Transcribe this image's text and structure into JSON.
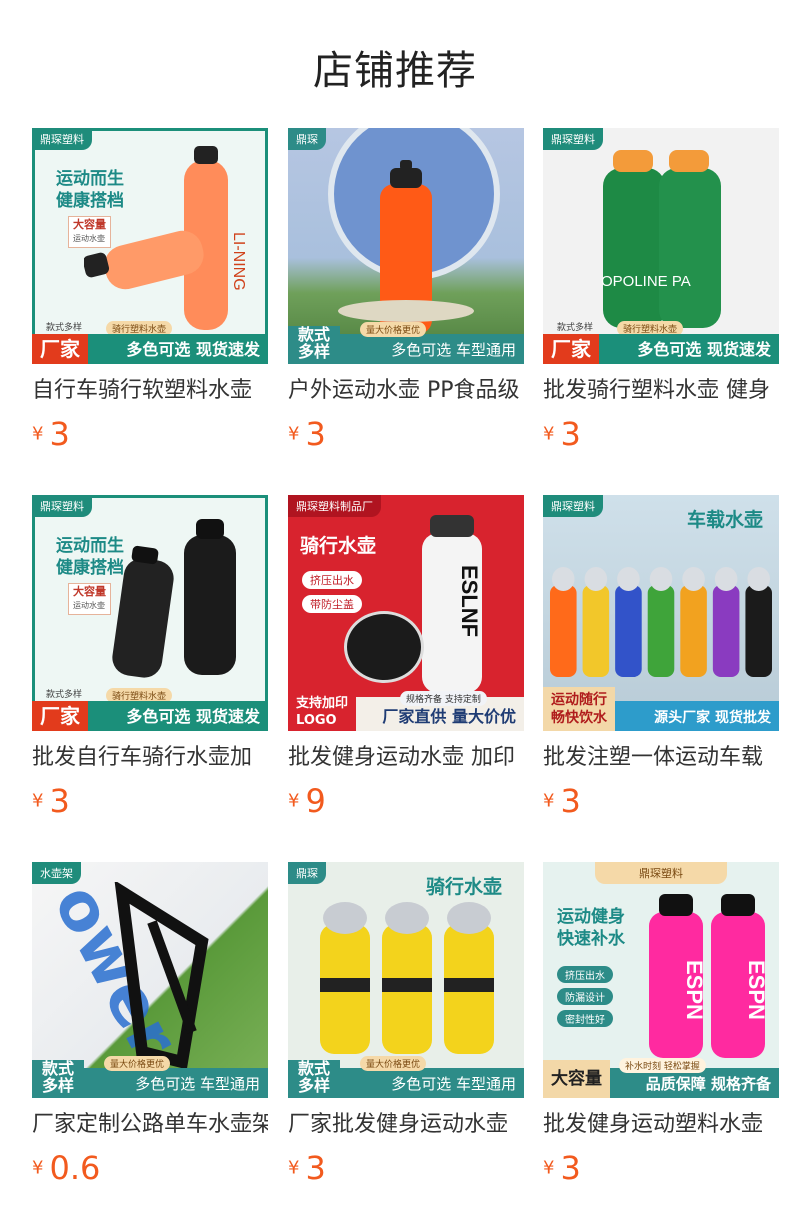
{
  "page": {
    "title": "店铺推荐"
  },
  "colors": {
    "price": "#f25a1e",
    "brand_teal": "#1b8f7a",
    "factory_red": "#e23b1c"
  },
  "currency": "¥",
  "products": [
    {
      "name": "自行车骑行软塑料水壶",
      "price": "3",
      "thumb": {
        "brand": "鼎琛塑料",
        "headline": [
          "运动而生",
          "健康搭档"
        ],
        "big": "大容量",
        "big_sub": "运动水壶",
        "small": "款式多样",
        "pill": "骑行塑料水壶",
        "left": "厂家",
        "band": "多色可选 现货速发",
        "bottle_color": "#ff8c5a",
        "bottle_text": "LI-NING",
        "icon": "orange-bottle-icon"
      }
    },
    {
      "name": "户外运动水壶 PP食品级",
      "price": "3",
      "thumb": {
        "brand": "鼎琛",
        "left_lines": [
          "款式",
          "多样"
        ],
        "pill": "量大价格更优",
        "band": "多色可选 车型通用",
        "bottle_color": "#ff5a16",
        "icon": "orange-bottle-icon"
      }
    },
    {
      "name": "批发骑行塑料水壶 健身",
      "price": "3",
      "thumb": {
        "brand": "鼎琛塑料",
        "small": "款式多样",
        "pill": "骑行塑料水壶",
        "left": "厂家",
        "band": "多色可选 现货速发",
        "bottle_color": "#1e8a45",
        "bottle_text": "OPOLINE PA",
        "icon": "green-bottle-icon"
      }
    },
    {
      "name": "批发自行车骑行水壶加",
      "price": "3",
      "thumb": {
        "brand": "鼎琛塑料",
        "headline": [
          "运动而生",
          "健康搭档"
        ],
        "big": "大容量",
        "big_sub": "运动水壶",
        "small": "款式多样",
        "pill": "骑行塑料水壶",
        "left": "厂家",
        "band": "多色可选 现货速发",
        "bottle_color": "#222222",
        "icon": "black-bottle-icon"
      }
    },
    {
      "name": "批发健身运动水壶 加印",
      "price": "9",
      "thumb": {
        "brand": "鼎琛塑料制品厂",
        "headline": [
          "骑行水壶"
        ],
        "chips": [
          "挤压出水",
          "带防尘盖"
        ],
        "left_lines": [
          "支持加印",
          "LOGO"
        ],
        "pill": "规格齐备 支持定制",
        "band": "厂家直供 量大价优",
        "bottle_color": "#f4f4f4",
        "bottle_text": "ESLNF",
        "icon": "white-bottle-icon"
      }
    },
    {
      "name": "批发注塑一体运动车载",
      "price": "3",
      "thumb": {
        "brand": "鼎琛塑料",
        "headline": [
          "车载水壶"
        ],
        "left_lines": [
          "运动随行",
          "畅快饮水"
        ],
        "band": "源头厂家 现货批发",
        "bottles": [
          "#ff6a1a",
          "#f2c72a",
          "#3253c9",
          "#3fa43a",
          "#f2a21f",
          "#8a3bc0",
          "#1b1b1b"
        ],
        "icon": "multicolor-bottles-icon"
      }
    },
    {
      "name": "厂家定制公路单车水壶架",
      "price": "0.6",
      "thumb": {
        "brand": "水壶架",
        "left_lines": [
          "款式",
          "多样"
        ],
        "pill": "量大价格更优",
        "band": "多色可选 车型通用",
        "frame_text": "ower",
        "icon": "bottle-cage-icon"
      }
    },
    {
      "name": "厂家批发健身运动水壶",
      "price": "3",
      "thumb": {
        "brand": "鼎琛",
        "headline": [
          "骑行水壶"
        ],
        "left_lines": [
          "款式",
          "多样"
        ],
        "pill": "量大价格更优",
        "band": "多色可选 车型通用",
        "bottle_color": "#f3d31c",
        "icon": "yellow-bottle-icon"
      }
    },
    {
      "name": "批发健身运动塑料水壶",
      "price": "3",
      "thumb": {
        "brand": "鼎琛塑料",
        "headline": [
          "运动健身",
          "快速补水"
        ],
        "chips": [
          "挤压出水",
          "防漏设计",
          "密封性好"
        ],
        "left": "大容量",
        "pill": "补水时刻 轻松掌握",
        "band": "品质保障 规格齐备",
        "bottle_color": "#ff2aa0",
        "bottle_text": "ESPN",
        "icon": "pink-bottle-icon"
      }
    }
  ]
}
